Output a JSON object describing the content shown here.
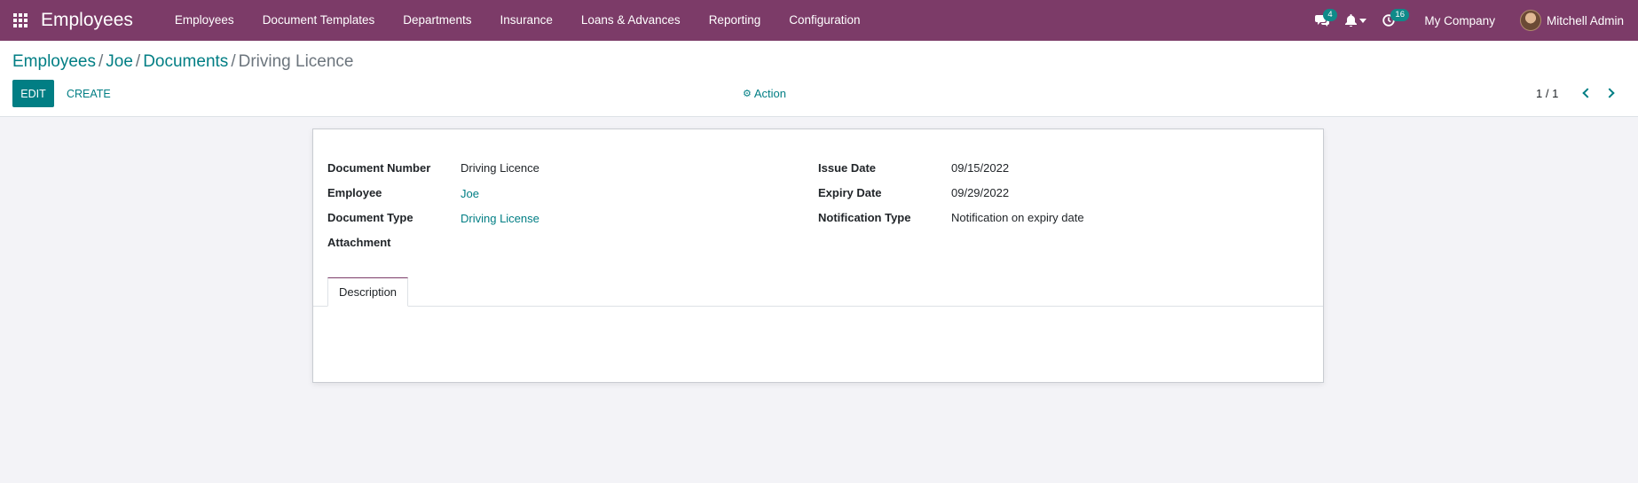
{
  "navbar": {
    "app_title": "Employees",
    "menu": [
      "Employees",
      "Document Templates",
      "Departments",
      "Insurance",
      "Loans & Advances",
      "Reporting",
      "Configuration"
    ],
    "messages_count": "4",
    "activities_count": "16",
    "company": "My Company",
    "user": "Mitchell Admin",
    "colors": {
      "bar": "#7c3b68",
      "badge": "#0f8a89"
    }
  },
  "breadcrumb": {
    "items": [
      "Employees",
      "Joe",
      "Documents"
    ],
    "current": "Driving Licence",
    "separator": "/"
  },
  "buttons": {
    "edit": "EDIT",
    "create": "CREATE",
    "action": "Action"
  },
  "pager": {
    "value": "1 / 1"
  },
  "form": {
    "left": [
      {
        "label": "Document Number",
        "value": "Driving Licence"
      },
      {
        "label": "Employee",
        "value": "Joe"
      },
      {
        "label": "Document Type",
        "value": "Driving License"
      },
      {
        "label": "Attachment",
        "value": ""
      }
    ],
    "right": [
      {
        "label": "Issue Date",
        "value": "09/15/2022"
      },
      {
        "label": "Expiry Date",
        "value": "09/29/2022"
      },
      {
        "label": "Notification Type",
        "value": "Notification on expiry date"
      }
    ]
  },
  "tabs": {
    "description": "Description"
  },
  "accent_color": "#017e84"
}
